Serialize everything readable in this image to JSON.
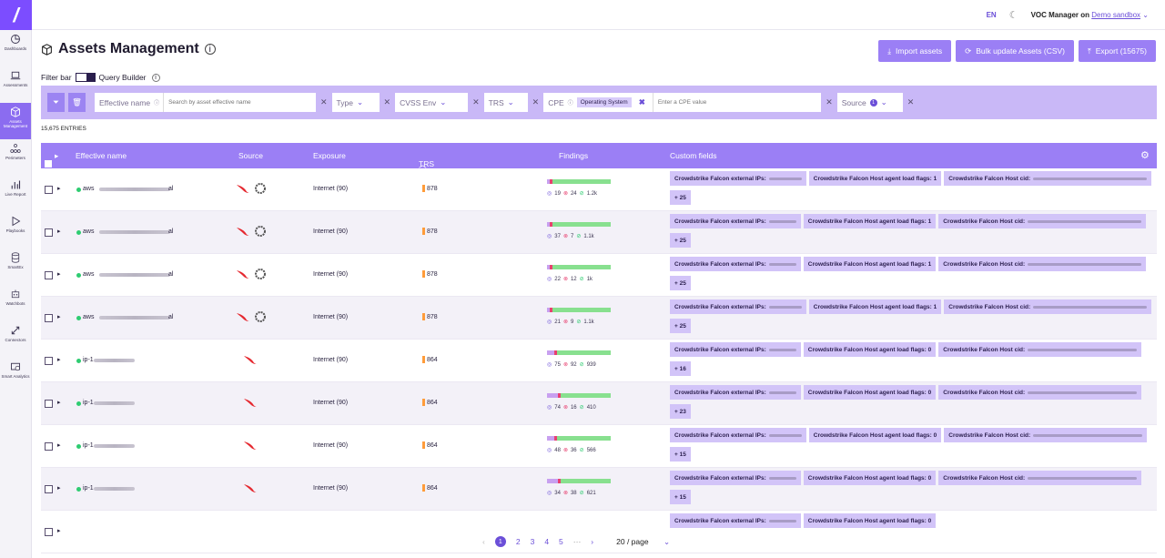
{
  "sidebar": {
    "items": [
      {
        "label": "Dashboards",
        "icon": "pie-chart-icon"
      },
      {
        "label": "Assessments",
        "icon": "laptop-icon"
      },
      {
        "label": "Assets Management",
        "icon": "cube-icon",
        "active": true
      },
      {
        "label": "Perimeters",
        "icon": "network-icon"
      },
      {
        "label": "Live Report",
        "icon": "bar-chart-icon"
      },
      {
        "label": "Playbooks",
        "icon": "play-icon"
      },
      {
        "label": "SmartEx",
        "icon": "database-icon"
      },
      {
        "label": "Watchbots",
        "icon": "robot-icon"
      },
      {
        "label": "Connectors",
        "icon": "arrows-icon"
      },
      {
        "label": "Smart Analytics",
        "icon": "analytics-icon"
      }
    ]
  },
  "topbar": {
    "lang": "EN",
    "user_prefix": "VOC Manager on",
    "env": "Demo sandbox"
  },
  "page": {
    "title": "Assets Management"
  },
  "actions": {
    "import": "Import assets",
    "bulk": "Bulk update Assets (CSV)",
    "export": "Export (15675)"
  },
  "filterbar": {
    "label": "Filter bar",
    "query_builder": "Query Builder"
  },
  "filters": {
    "effective_name_label": "Effective name",
    "effective_name_placeholder": "Search by asset effective name",
    "type": "Type",
    "cvss": "CVSS Env",
    "trs": "TRS",
    "cpe": "CPE",
    "cpe_chip": "Operating System",
    "cpe_placeholder": "Enter a CPE value",
    "source": "Source",
    "source_count": "1"
  },
  "entries": "15,675 ENTRIES",
  "table": {
    "headers": {
      "name": "Effective name",
      "source": "Source",
      "exposure": "Exposure",
      "trs": "TRS",
      "findings": "Findings",
      "custom": "Custom fields"
    },
    "rows": [
      {
        "name": "aws",
        "suffix": "al",
        "exposure": "Internet (90)",
        "trs": "878",
        "f1": "19",
        "f2": "24",
        "f3": "1.2k",
        "ext": "Crowdstrike Falcon external IPs:",
        "flags": "Crowdstrike Falcon Host agent load flags: 1",
        "cid": "Crowdstrike Falcon Host cid:",
        "more": "+ 25",
        "crowd": true,
        "circle": true,
        "flagsInline": true
      },
      {
        "name": "aws",
        "suffix": "al",
        "exposure": "Internet (90)",
        "trs": "878",
        "f1": "37",
        "f2": "7",
        "f3": "1.1k",
        "ext": "Crowdstrike Falcon external IPs:",
        "flags": "Crowdstrike Falcon Host agent load flags: 1",
        "cid": "Crowdstrike Falcon Host cid:",
        "more": "+ 25",
        "crowd": true,
        "circle": true,
        "flagsInline": true
      },
      {
        "name": "aws",
        "suffix": "al",
        "exposure": "Internet (90)",
        "trs": "878",
        "f1": "22",
        "f2": "12",
        "f3": "1k",
        "ext": "Crowdstrike Falcon external IPs:",
        "flags": "Crowdstrike Falcon Host agent load flags: 1",
        "cid": "Crowdstrike Falcon Host cid:",
        "more": "+ 25",
        "crowd": true,
        "circle": true,
        "flagsInline": true
      },
      {
        "name": "aws",
        "suffix": "al",
        "exposure": "Internet (90)",
        "trs": "878",
        "f1": "21",
        "f2": "9",
        "f3": "1.1k",
        "ext": "Crowdstrike Falcon external IPs:",
        "flags": "Crowdstrike Falcon Host agent load flags: 1",
        "cid": "Crowdstrike Falcon Host cid:",
        "more": "+ 25",
        "crowd": true,
        "circle": true,
        "flagsInline": true
      },
      {
        "name": "ip-1",
        "suffix": "",
        "exposure": "Internet (90)",
        "trs": "864",
        "f1": "75",
        "f2": "92",
        "f3": "939",
        "ext": "Crowdstrike Falcon external IPs:",
        "flags": "Crowdstrike Falcon Host agent load flags: 0",
        "cid": "Crowdstrike Falcon Host cid:",
        "more": "+ 16",
        "crowd": true,
        "circle": false,
        "flagsInline": true
      },
      {
        "name": "ip-1",
        "suffix": "",
        "exposure": "Internet (90)",
        "trs": "864",
        "f1": "74",
        "f2": "16",
        "f3": "410",
        "ext": "Crowdstrike Falcon external IPs:",
        "flags": "Crowdstrike Falcon Host agent load flags: 0",
        "cid": "Crowdstrike Falcon Host cid:",
        "more": "+ 23",
        "crowd": true,
        "circle": false,
        "flagsInline": true
      },
      {
        "name": "ip-1",
        "suffix": "",
        "exposure": "Internet (90)",
        "trs": "864",
        "f1": "48",
        "f2": "36",
        "f3": "566",
        "ext": "Crowdstrike Falcon external IPs:",
        "flags": "Crowdstrike Falcon Host agent load flags: 0",
        "cid": "Crowdstrike Falcon Host cid:",
        "more": "+ 15",
        "crowd": true,
        "circle": false,
        "flagsInline": true
      },
      {
        "name": "ip-1",
        "suffix": "",
        "exposure": "Internet (90)",
        "trs": "864",
        "f1": "34",
        "f2": "38",
        "f3": "621",
        "ext": "Crowdstrike Falcon external IPs:",
        "flags": "Crowdstrike Falcon Host agent load flags: 0",
        "cid": "Crowdstrike Falcon Host cid:",
        "more": "+ 15",
        "crowd": true,
        "circle": false,
        "flagsInline": true
      },
      {
        "name": "",
        "suffix": "",
        "exposure": "",
        "trs": "",
        "f1": "",
        "f2": "",
        "f3": "",
        "ext": "Crowdstrike Falcon external IPs:",
        "flags": "Crowdstrike Falcon Host agent load flags: 0",
        "cid": "",
        "more": "",
        "crowd": false,
        "circle": false,
        "flagsInline": true
      }
    ]
  },
  "pager": {
    "pages": [
      "1",
      "2",
      "3",
      "4",
      "5"
    ],
    "ellipsis": "···",
    "per_page": "20 / page"
  },
  "colors": {
    "accent": "#9b7ff5",
    "brand": "#7c4dff",
    "filter_bg": "#c9b8f7",
    "tag_bg": "#d2c4f8"
  }
}
